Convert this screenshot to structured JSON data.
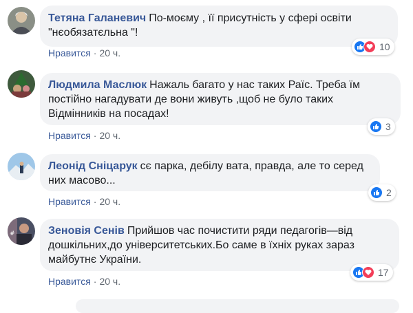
{
  "comments": [
    {
      "author": "Тетяна Галаневич",
      "text": "По-моєму , її присутність у сфері освіти \"нєобязатєльна \"!",
      "like_label": "Нравится",
      "time": "20 ч.",
      "reaction_count": "10",
      "reactions": [
        "like",
        "love"
      ]
    },
    {
      "author": "Людмила Маслюк",
      "text": "Нажаль багато у нас таких Раїс. Треба їм постійно нагадувати де вони живуть ,щоб не було таких Відмінників на посадах!",
      "like_label": "Нравится",
      "time": "20 ч.",
      "reaction_count": "3",
      "reactions": [
        "like"
      ]
    },
    {
      "author": "Леонід Сніцарук",
      "text": "сє парка, дебілу вата, правда, але то серед них масово...",
      "like_label": "Нравится",
      "time": "20 ч.",
      "reaction_count": "2",
      "reactions": [
        "like"
      ]
    },
    {
      "author": "Зеновія Сенів",
      "text": "Прийшов час почистити ряди педагогів—від дошкільних,до університетських.Бо саме в їхніх руках зараз майбутнє України.",
      "like_label": "Нравится",
      "time": "20 ч.",
      "reaction_count": "17",
      "reactions": [
        "like",
        "love"
      ]
    }
  ],
  "colors": {
    "author": "#385898",
    "bubble": "#f2f3f5",
    "like": "#1877f2",
    "love": "#f33e58"
  },
  "icons": {
    "like": "thumbs-up-icon",
    "love": "heart-icon"
  }
}
